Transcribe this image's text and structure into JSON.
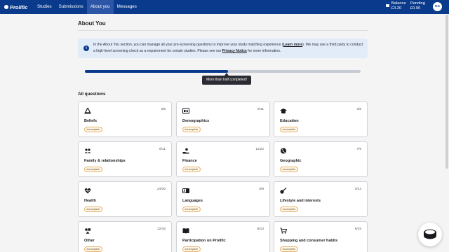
{
  "app": {
    "logo_text": "Prolific"
  },
  "nav": {
    "items": [
      {
        "label": "Studies",
        "active": false
      },
      {
        "label": "Submissions",
        "active": false
      },
      {
        "label": "About you",
        "active": true
      },
      {
        "label": "Messages",
        "active": false
      }
    ]
  },
  "header_stats": {
    "balance_label": "Balance",
    "balance_value": "£3.20",
    "pending_label": "Pending",
    "pending_value": "£0.00",
    "user_initials": "KS"
  },
  "page": {
    "title": "About You",
    "info": {
      "text_1": "In the About You section, you can manage all your pre-screening questions to improve your study matching experience (",
      "learn_more": "Learn more",
      "text_2": "). We may use a third party to conduct a high-level screening check as a requirement for certain studies. Please see our ",
      "privacy_notice": "Privacy Notice",
      "text_3": " for more information."
    },
    "progress": {
      "fraction": 0.52,
      "tooltip": "More than half completed!"
    },
    "section_title": "All questions"
  },
  "categories": [
    {
      "title": "Beliefs",
      "count": "3/9",
      "status": "Incomplete",
      "icon": "scales-icon"
    },
    {
      "title": "Demographics",
      "count": "9/11",
      "status": "Incomplete",
      "icon": "id-card-icon"
    },
    {
      "title": "Education",
      "count": "3/8",
      "status": "Incomplete",
      "icon": "graduation-cap-icon"
    },
    {
      "title": "Family & relationships",
      "count": "6/11",
      "status": "Incomplete",
      "icon": "people-icon"
    },
    {
      "title": "Finance",
      "count": "11/22",
      "status": "Incomplete",
      "icon": "money-hand-icon"
    },
    {
      "title": "Geographic",
      "count": "7/9",
      "status": "Incomplete",
      "icon": "globe-icon"
    },
    {
      "title": "Health",
      "count": "24/30",
      "status": "Incomplete",
      "icon": "heartbeat-icon"
    },
    {
      "title": "Languages",
      "count": "6/8",
      "status": "Incomplete",
      "icon": "language-icon"
    },
    {
      "title": "Lifestyle and interests",
      "count": "3/13",
      "status": "Incomplete",
      "icon": "guitar-icon"
    },
    {
      "title": "Other",
      "count": "12/16",
      "status": "Incomplete",
      "icon": "other-icon"
    },
    {
      "title": "Participation on Prolific",
      "count": "8/13",
      "status": "Incomplete",
      "icon": "book-icon"
    },
    {
      "title": "Shopping and consumer habits",
      "count": "9/15",
      "status": "Incomplete",
      "icon": "cart-icon"
    }
  ],
  "colors": {
    "brand": "#0a3a8c",
    "badge_border": "#e7b26b"
  }
}
